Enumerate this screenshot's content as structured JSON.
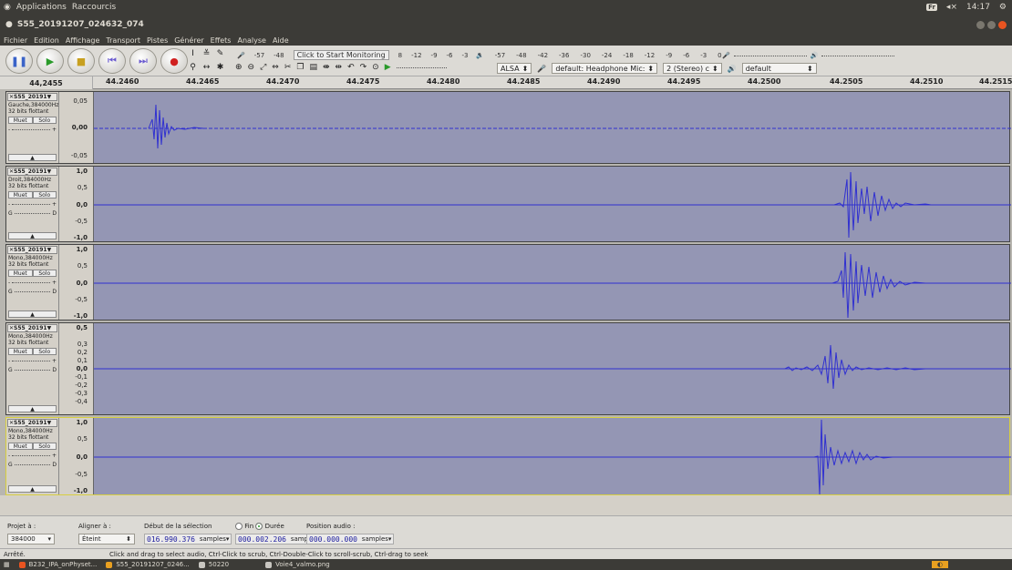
{
  "topbar": {
    "applications": "Applications",
    "shortcuts": "Raccourcis",
    "keyboard": "Fr",
    "volume": "◂×",
    "clock": "14:17"
  },
  "window": {
    "title": "S55_20191207_024632_074"
  },
  "menu": [
    "Fichier",
    "Edition",
    "Affichage",
    "Transport",
    "Pistes",
    "Générer",
    "Effets",
    "Analyse",
    "Aide"
  ],
  "toolbar": {
    "rec_meter_ticks": [
      "-57",
      "-48"
    ],
    "monitor_label": "Click to Start Monitoring",
    "rec_meter_ticks_right": [
      "8",
      "-12",
      "-9",
      "-6",
      "-3",
      "0"
    ],
    "play_meter_ticks": [
      "-57",
      "-48",
      "-42",
      "-36",
      "-30",
      "-24",
      "-18",
      "-12",
      "-9",
      "-6",
      "-3",
      "0"
    ],
    "host": "ALSA",
    "rec_device": "default: Headphone Mic:",
    "channels": "2 (Stereo) c",
    "play_device": "default"
  },
  "ruler": {
    "position": "44,2455",
    "ticks": [
      "44.2460",
      "44.2465",
      "44.2470",
      "44.2475",
      "44.2480",
      "44.2485",
      "44.2490",
      "44.2495",
      "44.2500",
      "44.2505",
      "44.2510",
      "44.2515"
    ]
  },
  "tracks": [
    {
      "name": "S55_20191",
      "info": "Gauche,384000Hz",
      "format": "32 bits flottant",
      "mute": "Muet",
      "solo": "Solo",
      "gain_l": "-",
      "gain_r": "+",
      "pan_l": "",
      "pan_r": "",
      "scale": [
        "0,05",
        "0,00",
        "-0,05"
      ],
      "selected": false
    },
    {
      "name": "S55_20191",
      "info": "Droit,384000Hz",
      "format": "32 bits flottant",
      "mute": "Muet",
      "solo": "Solo",
      "gain_l": "-",
      "gain_r": "+",
      "pan_l": "G",
      "pan_r": "D",
      "scale": [
        "1,0",
        "0,5",
        "0,0",
        "-0,5",
        "-1,0"
      ],
      "selected": false
    },
    {
      "name": "S55_20191",
      "info": "Mono,384000Hz",
      "format": "32 bits flottant",
      "mute": "Muet",
      "solo": "Solo",
      "gain_l": "-",
      "gain_r": "+",
      "pan_l": "G",
      "pan_r": "D",
      "scale": [
        "1,0",
        "0,5",
        "0,0",
        "-0,5",
        "-1,0"
      ],
      "selected": false
    },
    {
      "name": "S55_20191",
      "info": "Mono,384000Hz",
      "format": "32 bits flottant",
      "mute": "Muet",
      "solo": "Solo",
      "gain_l": "-",
      "gain_r": "+",
      "pan_l": "G",
      "pan_r": "D",
      "scale": [
        "0,5",
        "0,3",
        "0,2",
        "0,1",
        "0,0",
        "-0,1",
        "-0,2",
        "-0,3",
        "-0,4"
      ],
      "selected": false
    },
    {
      "name": "S55_20191",
      "info": "Mono,384000Hz",
      "format": "32 bits flottant",
      "mute": "Muet",
      "solo": "Solo",
      "gain_l": "-",
      "gain_r": "+",
      "pan_l": "G",
      "pan_r": "D",
      "scale": [
        "1,0",
        "0,5",
        "0,0",
        "-0,5",
        "-1,0"
      ],
      "selected": true
    }
  ],
  "selection": {
    "project_label": "Projet à :",
    "project_rate": "384000",
    "snap_label": "Aligner à :",
    "snap_value": "Éteint",
    "start_label": "Début de la sélection",
    "end_label": "Fin",
    "duration_label": "Durée",
    "audio_pos_label": "Position audio :",
    "start_value": "016.990.376",
    "duration_value": "000.002.206",
    "audio_pos_value": "000.000.000",
    "unit": "samples"
  },
  "status": {
    "state": "Arrêté.",
    "hint": "Click and drag to select audio, Ctrl-Click to scrub, Ctrl-Double-Click to scroll-scrub, Ctrl-drag to seek"
  },
  "taskbar": [
    "B232_IPA_onPhyset...",
    "S55_20191207_0246...",
    "50220",
    "Voie4_valmo.png"
  ],
  "colors": {
    "wave_bg": "#9496b4",
    "waveform": "#3030d0",
    "accent": "#e95420"
  }
}
